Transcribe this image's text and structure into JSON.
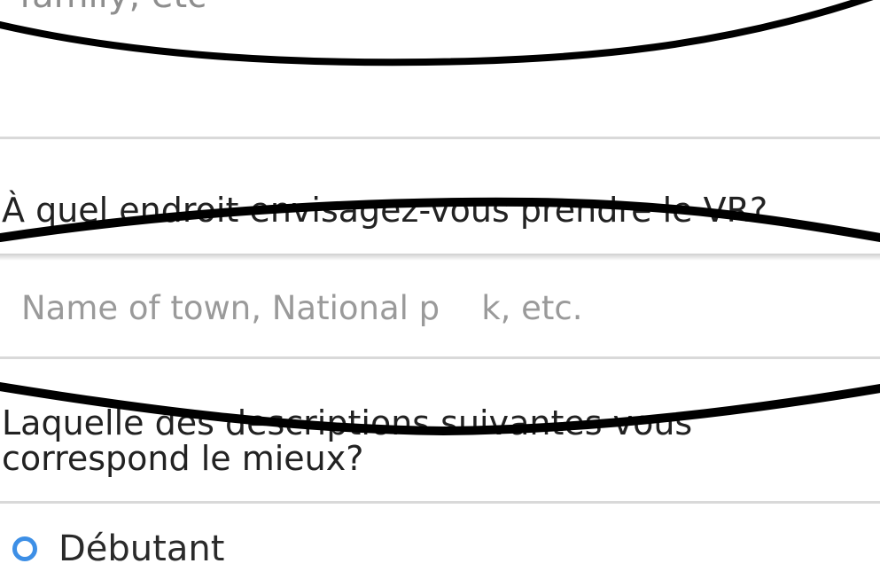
{
  "top_hint": {
    "text": "family, etc"
  },
  "question_location": {
    "label": "À quel endroit envisagez-vous prendre le VR?"
  },
  "location_input": {
    "placeholder": "Name of town, National p    k, etc.",
    "value": ""
  },
  "question_description": {
    "line1": "Laquelle des descriptions suivantes vous",
    "line2": "correspond le mieux?"
  },
  "experience_options": [
    {
      "label": "Débutant",
      "selected": false
    }
  ],
  "colors": {
    "radio_accent": "#3d8fe6",
    "placeholder": "#9a9a9a",
    "divider": "#d9d9d9",
    "scribble": "#000000"
  }
}
